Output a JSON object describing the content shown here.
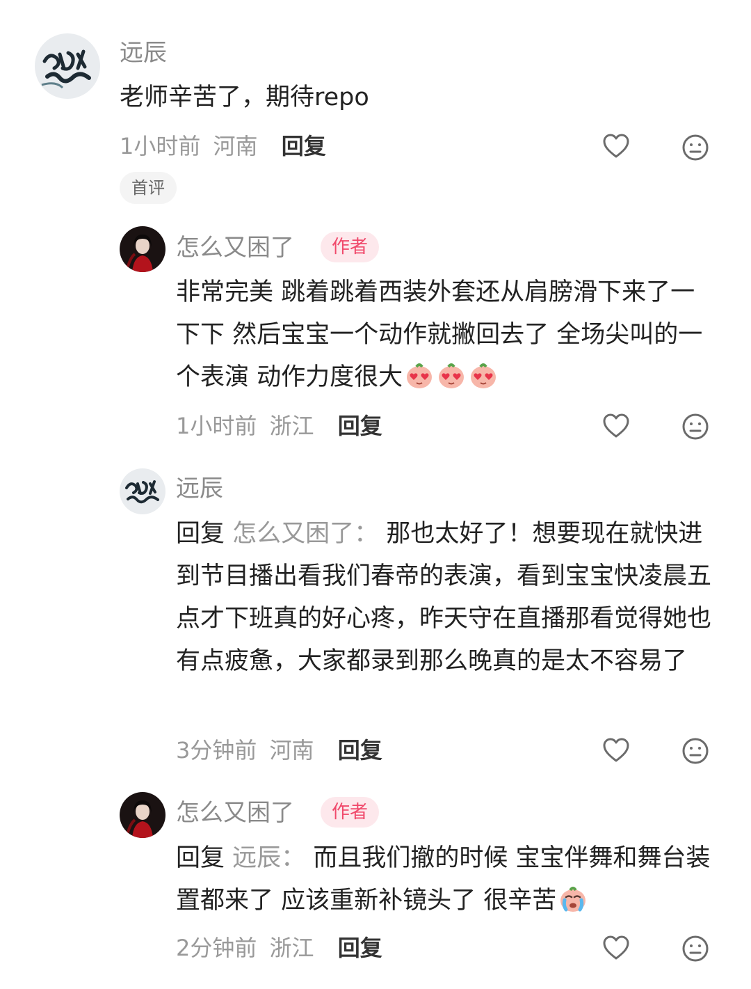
{
  "comments": [
    {
      "user": "远辰",
      "text": "老师辛苦了，期待repo",
      "time": "1小时前",
      "location": "河南",
      "reply_label": "回复",
      "tag": "首评"
    },
    {
      "user": "怎么又困了",
      "badge": "作者",
      "text": "非常完美 跳着跳着西装外套还从肩膀滑下来了一下下 然后宝宝一个动作就撇回去了 全场尖叫的一个表演 动作力度很大",
      "time": "1小时前",
      "location": "浙江",
      "reply_label": "回复"
    },
    {
      "user": "远辰",
      "reply_prefix": "回复",
      "reply_target": "怎么又困了：",
      "text": "那也太好了！想要现在就快进到节目播出看我们春帝的表演，看到宝宝快凌晨五点才下班真的好心疼，昨天守在直播那看觉得她也有点疲惫，大家都录到那么晚真的是太不容易了",
      "time": "3分钟前",
      "location": "河南",
      "reply_label": "回复"
    },
    {
      "user": "怎么又困了",
      "badge": "作者",
      "reply_prefix": "回复",
      "reply_target": "远辰：",
      "text": "而且我们撤的时候 宝宝伴舞和舞台装置都来了 应该重新补镜头了 很辛苦",
      "time": "2分钟前",
      "location": "浙江",
      "reply_label": "回复"
    }
  ],
  "icons": {
    "like": "heart-outline-icon",
    "dislike": "neutral-face-icon",
    "emoji_love": "heart-eyes-peach-emoji",
    "emoji_cry": "crying-peach-emoji"
  },
  "colors": {
    "badge_bg": "#fde8ec",
    "badge_text": "#f0496b",
    "meta_text": "#999999",
    "name_text": "#8a8a8a"
  }
}
